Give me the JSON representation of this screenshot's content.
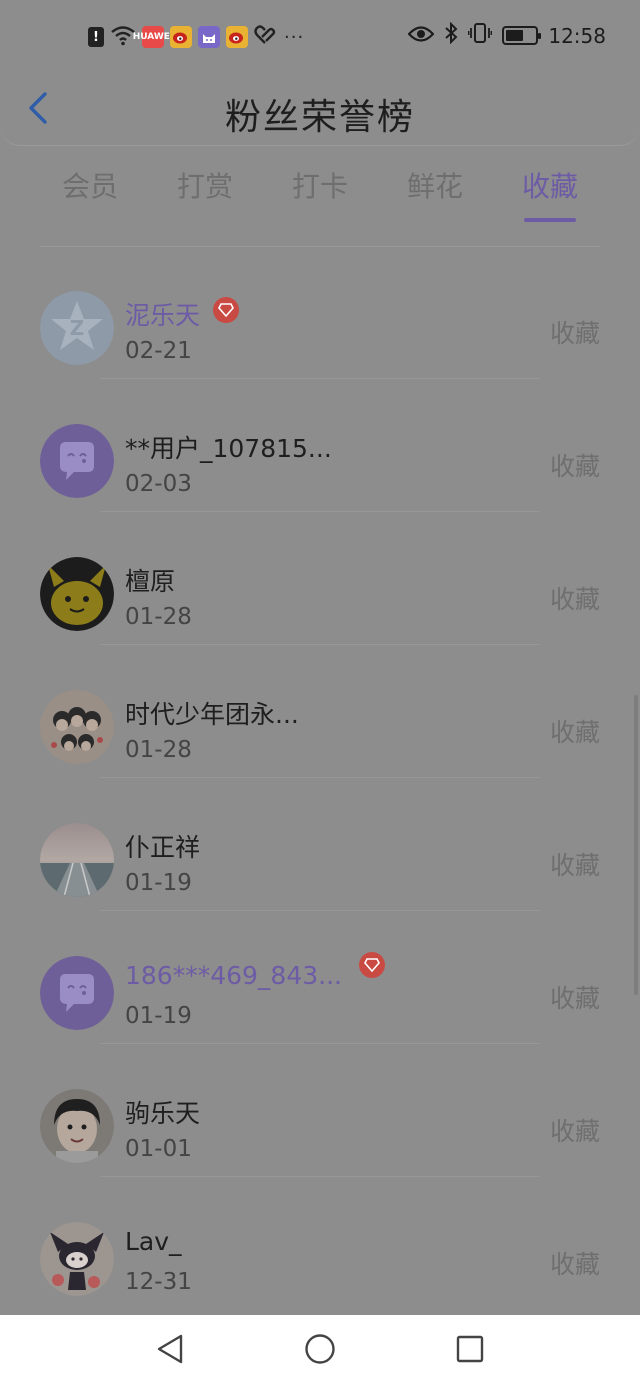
{
  "status_bar": {
    "time": "12:58",
    "alert_icon_text": "!",
    "app_icon_text": "HUAWEI",
    "dots": "···"
  },
  "header": {
    "title": "粉丝荣誉榜"
  },
  "tabs": [
    {
      "label": "会员",
      "active": false
    },
    {
      "label": "打赏",
      "active": false
    },
    {
      "label": "打卡",
      "active": false
    },
    {
      "label": "鲜花",
      "active": false
    },
    {
      "label": "收藏",
      "active": true
    }
  ],
  "rows": [
    {
      "name": "泥乐天",
      "date": "02-21",
      "action": "收藏",
      "vip": true,
      "badge": true
    },
    {
      "name": "**用户_107815...",
      "date": "02-03",
      "action": "收藏",
      "vip": false,
      "badge": false
    },
    {
      "name": "檀原",
      "date": "01-28",
      "action": "收藏",
      "vip": false,
      "badge": false
    },
    {
      "name": "时代少年团永...",
      "date": "01-28",
      "action": "收藏",
      "vip": false,
      "badge": false
    },
    {
      "name": "仆正祥",
      "date": "01-19",
      "action": "收藏",
      "vip": false,
      "badge": false
    },
    {
      "name": "186***469_843...",
      "date": "01-19",
      "action": "收藏",
      "vip": true,
      "badge": true
    },
    {
      "name": "驹乐天",
      "date": "01-01",
      "action": "收藏",
      "vip": false,
      "badge": false
    },
    {
      "name": "Lav_",
      "date": "12-31",
      "action": "收藏",
      "vip": false,
      "badge": false
    }
  ],
  "colors": {
    "accent": "#6d5ca5",
    "badge": "#c94a43",
    "overlay": "#8d8d8d"
  }
}
